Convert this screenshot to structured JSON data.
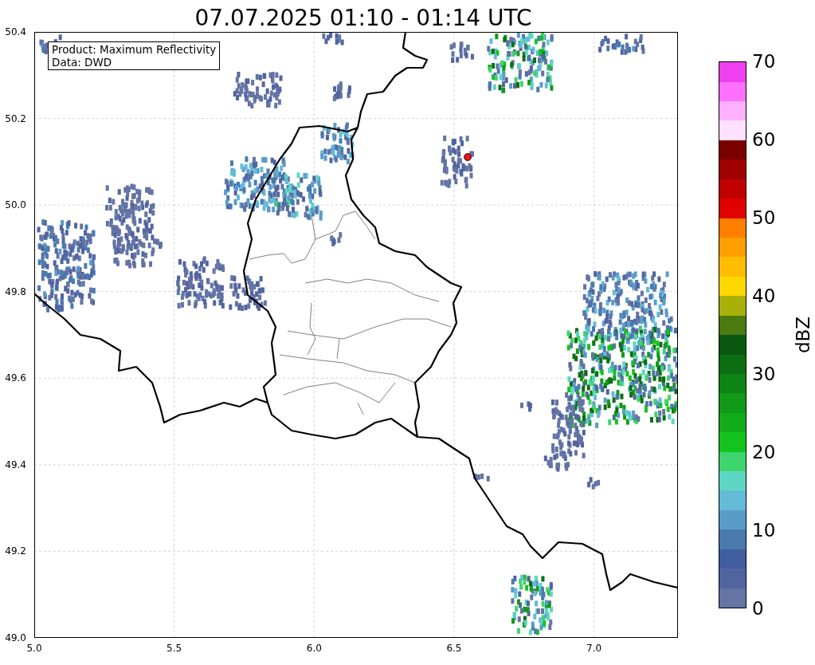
{
  "title": "07.07.2025 01:10 - 01:14 UTC",
  "map": {
    "info_box": [
      "Product: Maximum Reflectivity",
      "Data: DWD"
    ],
    "x_ticks": [
      "5.0",
      "5.5",
      "6.0",
      "6.5",
      "7.0"
    ],
    "y_ticks": [
      "50.4",
      "50.2",
      "50.0",
      "49.8",
      "49.6",
      "49.4",
      "49.2",
      "49.0"
    ]
  },
  "colorbar": {
    "label": "dBZ",
    "ticks": [
      "70",
      "60",
      "50",
      "40",
      "30",
      "20",
      "10",
      "0"
    ],
    "segments": [
      {
        "color": "#6474a4"
      },
      {
        "color": "#5264a0"
      },
      {
        "color": "#405ea0"
      },
      {
        "color": "#4a7ab0"
      },
      {
        "color": "#5a9cc8"
      },
      {
        "color": "#62bcd8"
      },
      {
        "color": "#5ed6c4"
      },
      {
        "color": "#3ed46e"
      },
      {
        "color": "#14c41c"
      },
      {
        "color": "#12ac1a"
      },
      {
        "color": "#109a18"
      },
      {
        "color": "#0e8414"
      },
      {
        "color": "#0c6e12"
      },
      {
        "color": "#0a5810"
      },
      {
        "color": "#4a7a10"
      },
      {
        "color": "#aab00a"
      },
      {
        "color": "#ffd800"
      },
      {
        "color": "#ffbc00"
      },
      {
        "color": "#ffa000"
      },
      {
        "color": "#ff8000"
      },
      {
        "color": "#e00000"
      },
      {
        "color": "#c00000"
      },
      {
        "color": "#a00000"
      },
      {
        "color": "#7a0000"
      },
      {
        "color": "#ffe0ff"
      },
      {
        "color": "#ffb0ff"
      },
      {
        "color": "#ff70ff"
      },
      {
        "color": "#ee40ee"
      }
    ]
  }
}
